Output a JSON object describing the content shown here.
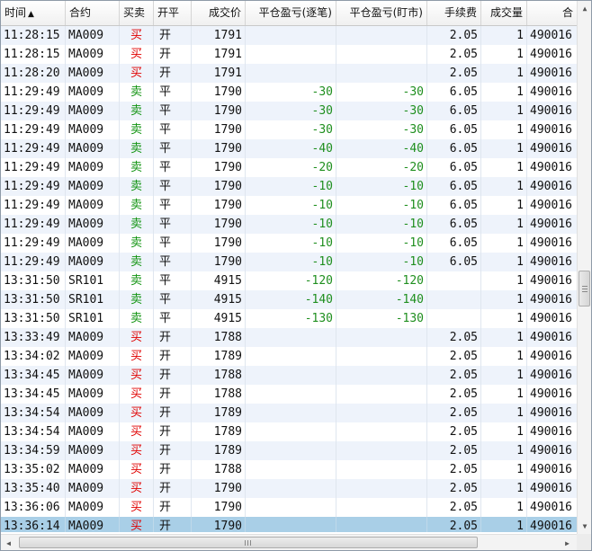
{
  "columns": {
    "time": "时间",
    "contract": "合约",
    "side": "买卖",
    "open_close": "开平",
    "price": "成交价",
    "pnl_trade": "平仓盈亏(逐笔)",
    "pnl_mtm": "平仓盈亏(盯市)",
    "fee": "手续费",
    "qty": "成交量",
    "account": "合"
  },
  "colors": {
    "buy": "#e00000",
    "sell": "#129412",
    "pnl": "#1f8f1f",
    "selected_row": "#a9cfe7"
  },
  "rows": [
    {
      "time": "11:28:15",
      "contract": "MA009",
      "side": "买",
      "oc": "开",
      "price": "1791",
      "pnl1": "",
      "pnl2": "",
      "fee": "2.05",
      "qty": "1",
      "acct": "490016"
    },
    {
      "time": "11:28:15",
      "contract": "MA009",
      "side": "买",
      "oc": "开",
      "price": "1791",
      "pnl1": "",
      "pnl2": "",
      "fee": "2.05",
      "qty": "1",
      "acct": "490016"
    },
    {
      "time": "11:28:20",
      "contract": "MA009",
      "side": "买",
      "oc": "开",
      "price": "1791",
      "pnl1": "",
      "pnl2": "",
      "fee": "2.05",
      "qty": "1",
      "acct": "490016"
    },
    {
      "time": "11:29:49",
      "contract": "MA009",
      "side": "卖",
      "oc": "平",
      "price": "1790",
      "pnl1": "-30",
      "pnl2": "-30",
      "fee": "6.05",
      "qty": "1",
      "acct": "490016"
    },
    {
      "time": "11:29:49",
      "contract": "MA009",
      "side": "卖",
      "oc": "平",
      "price": "1790",
      "pnl1": "-30",
      "pnl2": "-30",
      "fee": "6.05",
      "qty": "1",
      "acct": "490016"
    },
    {
      "time": "11:29:49",
      "contract": "MA009",
      "side": "卖",
      "oc": "平",
      "price": "1790",
      "pnl1": "-30",
      "pnl2": "-30",
      "fee": "6.05",
      "qty": "1",
      "acct": "490016"
    },
    {
      "time": "11:29:49",
      "contract": "MA009",
      "side": "卖",
      "oc": "平",
      "price": "1790",
      "pnl1": "-40",
      "pnl2": "-40",
      "fee": "6.05",
      "qty": "1",
      "acct": "490016"
    },
    {
      "time": "11:29:49",
      "contract": "MA009",
      "side": "卖",
      "oc": "平",
      "price": "1790",
      "pnl1": "-20",
      "pnl2": "-20",
      "fee": "6.05",
      "qty": "1",
      "acct": "490016"
    },
    {
      "time": "11:29:49",
      "contract": "MA009",
      "side": "卖",
      "oc": "平",
      "price": "1790",
      "pnl1": "-10",
      "pnl2": "-10",
      "fee": "6.05",
      "qty": "1",
      "acct": "490016"
    },
    {
      "time": "11:29:49",
      "contract": "MA009",
      "side": "卖",
      "oc": "平",
      "price": "1790",
      "pnl1": "-10",
      "pnl2": "-10",
      "fee": "6.05",
      "qty": "1",
      "acct": "490016"
    },
    {
      "time": "11:29:49",
      "contract": "MA009",
      "side": "卖",
      "oc": "平",
      "price": "1790",
      "pnl1": "-10",
      "pnl2": "-10",
      "fee": "6.05",
      "qty": "1",
      "acct": "490016"
    },
    {
      "time": "11:29:49",
      "contract": "MA009",
      "side": "卖",
      "oc": "平",
      "price": "1790",
      "pnl1": "-10",
      "pnl2": "-10",
      "fee": "6.05",
      "qty": "1",
      "acct": "490016"
    },
    {
      "time": "11:29:49",
      "contract": "MA009",
      "side": "卖",
      "oc": "平",
      "price": "1790",
      "pnl1": "-10",
      "pnl2": "-10",
      "fee": "6.05",
      "qty": "1",
      "acct": "490016"
    },
    {
      "time": "13:31:50",
      "contract": "SR101",
      "side": "卖",
      "oc": "平",
      "price": "4915",
      "pnl1": "-120",
      "pnl2": "-120",
      "fee": "",
      "qty": "1",
      "acct": "490016"
    },
    {
      "time": "13:31:50",
      "contract": "SR101",
      "side": "卖",
      "oc": "平",
      "price": "4915",
      "pnl1": "-140",
      "pnl2": "-140",
      "fee": "",
      "qty": "1",
      "acct": "490016"
    },
    {
      "time": "13:31:50",
      "contract": "SR101",
      "side": "卖",
      "oc": "平",
      "price": "4915",
      "pnl1": "-130",
      "pnl2": "-130",
      "fee": "",
      "qty": "1",
      "acct": "490016"
    },
    {
      "time": "13:33:49",
      "contract": "MA009",
      "side": "买",
      "oc": "开",
      "price": "1788",
      "pnl1": "",
      "pnl2": "",
      "fee": "2.05",
      "qty": "1",
      "acct": "490016"
    },
    {
      "time": "13:34:02",
      "contract": "MA009",
      "side": "买",
      "oc": "开",
      "price": "1789",
      "pnl1": "",
      "pnl2": "",
      "fee": "2.05",
      "qty": "1",
      "acct": "490016"
    },
    {
      "time": "13:34:45",
      "contract": "MA009",
      "side": "买",
      "oc": "开",
      "price": "1788",
      "pnl1": "",
      "pnl2": "",
      "fee": "2.05",
      "qty": "1",
      "acct": "490016"
    },
    {
      "time": "13:34:45",
      "contract": "MA009",
      "side": "买",
      "oc": "开",
      "price": "1788",
      "pnl1": "",
      "pnl2": "",
      "fee": "2.05",
      "qty": "1",
      "acct": "490016"
    },
    {
      "time": "13:34:54",
      "contract": "MA009",
      "side": "买",
      "oc": "开",
      "price": "1789",
      "pnl1": "",
      "pnl2": "",
      "fee": "2.05",
      "qty": "1",
      "acct": "490016"
    },
    {
      "time": "13:34:54",
      "contract": "MA009",
      "side": "买",
      "oc": "开",
      "price": "1789",
      "pnl1": "",
      "pnl2": "",
      "fee": "2.05",
      "qty": "1",
      "acct": "490016"
    },
    {
      "time": "13:34:59",
      "contract": "MA009",
      "side": "买",
      "oc": "开",
      "price": "1789",
      "pnl1": "",
      "pnl2": "",
      "fee": "2.05",
      "qty": "1",
      "acct": "490016"
    },
    {
      "time": "13:35:02",
      "contract": "MA009",
      "side": "买",
      "oc": "开",
      "price": "1788",
      "pnl1": "",
      "pnl2": "",
      "fee": "2.05",
      "qty": "1",
      "acct": "490016"
    },
    {
      "time": "13:35:40",
      "contract": "MA009",
      "side": "买",
      "oc": "开",
      "price": "1790",
      "pnl1": "",
      "pnl2": "",
      "fee": "2.05",
      "qty": "1",
      "acct": "490016"
    },
    {
      "time": "13:36:06",
      "contract": "MA009",
      "side": "买",
      "oc": "开",
      "price": "1790",
      "pnl1": "",
      "pnl2": "",
      "fee": "2.05",
      "qty": "1",
      "acct": "490016"
    },
    {
      "time": "13:36:14",
      "contract": "MA009",
      "side": "买",
      "oc": "开",
      "price": "1790",
      "pnl1": "",
      "pnl2": "",
      "fee": "2.05",
      "qty": "1",
      "acct": "490016",
      "selected": true
    }
  ],
  "icons": {
    "sort": "sort-ascending-icon",
    "scroll_up": "scroll-up-arrow-icon",
    "scroll_down": "scroll-down-arrow-icon",
    "scroll_left": "scroll-left-arrow-icon",
    "scroll_right": "scroll-right-arrow-icon"
  }
}
